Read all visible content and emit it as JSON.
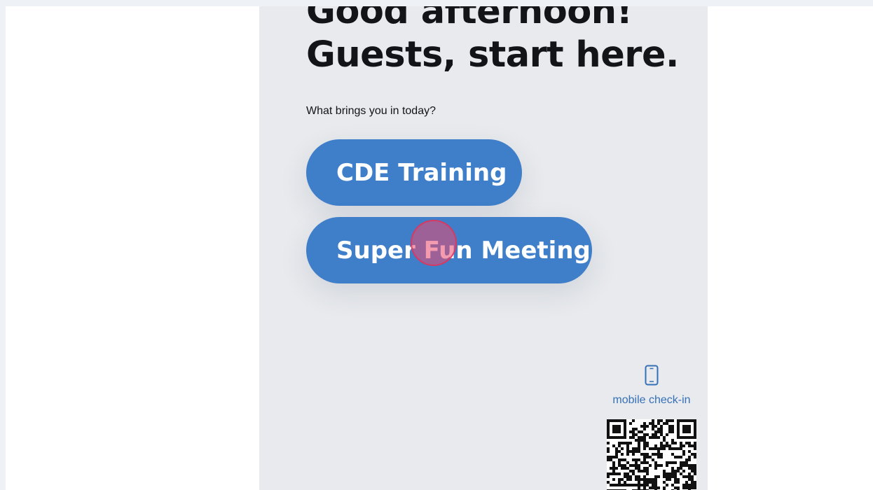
{
  "kiosk": {
    "greeting": "Good afternoon!",
    "heading": "Guests, start here.",
    "question": "What brings you in today?",
    "options": [
      "CDE Training",
      "Super Fun Meeting"
    ],
    "mobile_checkin_label": "mobile check-in",
    "mobile_icon": "phone-icon",
    "qr_icon": "qr-code"
  },
  "colors": {
    "page_bg": "#ffffff",
    "kiosk_bg": "#e8eaed",
    "button_bg": "#3f7ec9",
    "button_text": "#ffffff",
    "heading_text": "#121418",
    "link_text": "#3570b6",
    "click_marker": "#ec486e"
  }
}
